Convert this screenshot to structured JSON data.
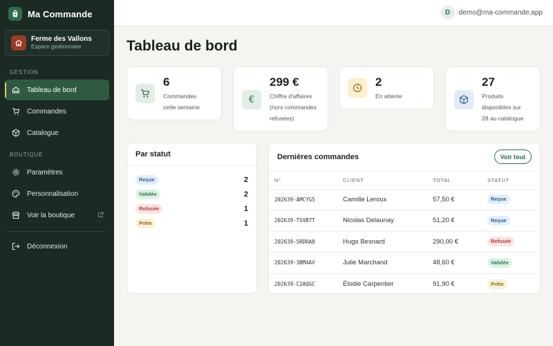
{
  "app": {
    "name": "Ma Commande"
  },
  "shop": {
    "name": "Ferme des Vallons",
    "subtitle": "Espace gestionnaire"
  },
  "sidebar": {
    "sections": [
      {
        "title": "GESTION",
        "items": [
          {
            "label": "Tableau de bord",
            "icon": "dashboard-icon",
            "active": true
          },
          {
            "label": "Commandes",
            "icon": "cart-icon"
          },
          {
            "label": "Catalogue",
            "icon": "box-icon"
          }
        ]
      },
      {
        "title": "BOUTIQUE",
        "items": [
          {
            "label": "Paramètres",
            "icon": "gear-icon"
          },
          {
            "label": "Personnalisation",
            "icon": "palette-icon"
          },
          {
            "label": "Voir la boutique",
            "icon": "store-icon",
            "external": true
          }
        ]
      }
    ],
    "logout": {
      "label": "Déconnexion",
      "icon": "logout-icon"
    }
  },
  "user": {
    "initial": "D",
    "email": "demo@ma-commande.app"
  },
  "page": {
    "title": "Tableau de bord"
  },
  "stats": [
    {
      "value": "6",
      "label_lines": [
        "Commandes",
        "cette semaine"
      ],
      "icon": "cart-icon"
    },
    {
      "value": "299 €",
      "label_lines": [
        "Chiffre d'affaires",
        "(hors commandes",
        "refusées)"
      ],
      "icon": "euro-icon"
    },
    {
      "value": "2",
      "label_lines": [
        "En attente"
      ],
      "icon": "clock-icon"
    },
    {
      "value": "27",
      "label_lines": [
        "Produits",
        "disponibles sur",
        "28 au catalogue"
      ],
      "icon": "box-icon"
    }
  ],
  "by_status": {
    "title": "Par statut",
    "rows": [
      {
        "label": "Reçue",
        "count": "2"
      },
      {
        "label": "Validée",
        "count": "2"
      },
      {
        "label": "Refusée",
        "count": "1"
      },
      {
        "label": "Prête",
        "count": "1"
      }
    ]
  },
  "recent_orders": {
    "title": "Dernières commandes",
    "view_all_label": "Voir tout",
    "columns": [
      "N°",
      "CLIENT",
      "TOTAL",
      "STATUT"
    ],
    "rows": [
      {
        "number": "202639-AMCYG5",
        "client": "Camille Leroux",
        "total": "57,50 €",
        "status": "Reçue"
      },
      {
        "number": "202639-TSVB7T",
        "client": "Nicolas Delaunay",
        "total": "51,20 €",
        "status": "Reçue"
      },
      {
        "number": "202639-5RDRA8",
        "client": "Hugo Besnard",
        "total": "290,00 €",
        "status": "Refusée"
      },
      {
        "number": "202639-3BM4AV",
        "client": "Julie Marchand",
        "total": "48,60 €",
        "status": "Validée"
      },
      {
        "number": "202639-C2AQGC",
        "client": "Élodie Carpentier",
        "total": "91,90 €",
        "status": "Prête"
      }
    ]
  },
  "colors": {
    "sidebar_bg": "#1b2b23",
    "active_nav": "#2e5a42",
    "accent_green": "#2f6b4c",
    "shop_icon": "#9a3b25"
  }
}
